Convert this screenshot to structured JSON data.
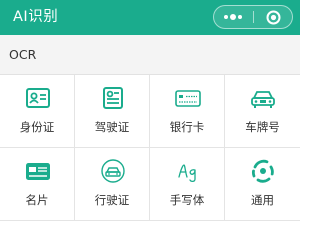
{
  "header": {
    "title": "AI识别",
    "more_icon": "more-dots-icon",
    "close_icon": "record-close-icon"
  },
  "section": {
    "title": "OCR"
  },
  "colors": {
    "brand": "#1aac8d",
    "icon": "#1aac8d"
  },
  "items": [
    {
      "label": "身份证",
      "icon": "id-card-icon"
    },
    {
      "label": "驾驶证",
      "icon": "driver-license-icon"
    },
    {
      "label": "银行卡",
      "icon": "bank-card-icon"
    },
    {
      "label": "车牌号",
      "icon": "license-plate-icon"
    },
    {
      "label": "名片",
      "icon": "business-card-icon"
    },
    {
      "label": "行驶证",
      "icon": "vehicle-license-icon"
    },
    {
      "label": "手写体",
      "icon": "handwriting-icon"
    },
    {
      "label": "通用",
      "icon": "general-ocr-icon"
    }
  ]
}
